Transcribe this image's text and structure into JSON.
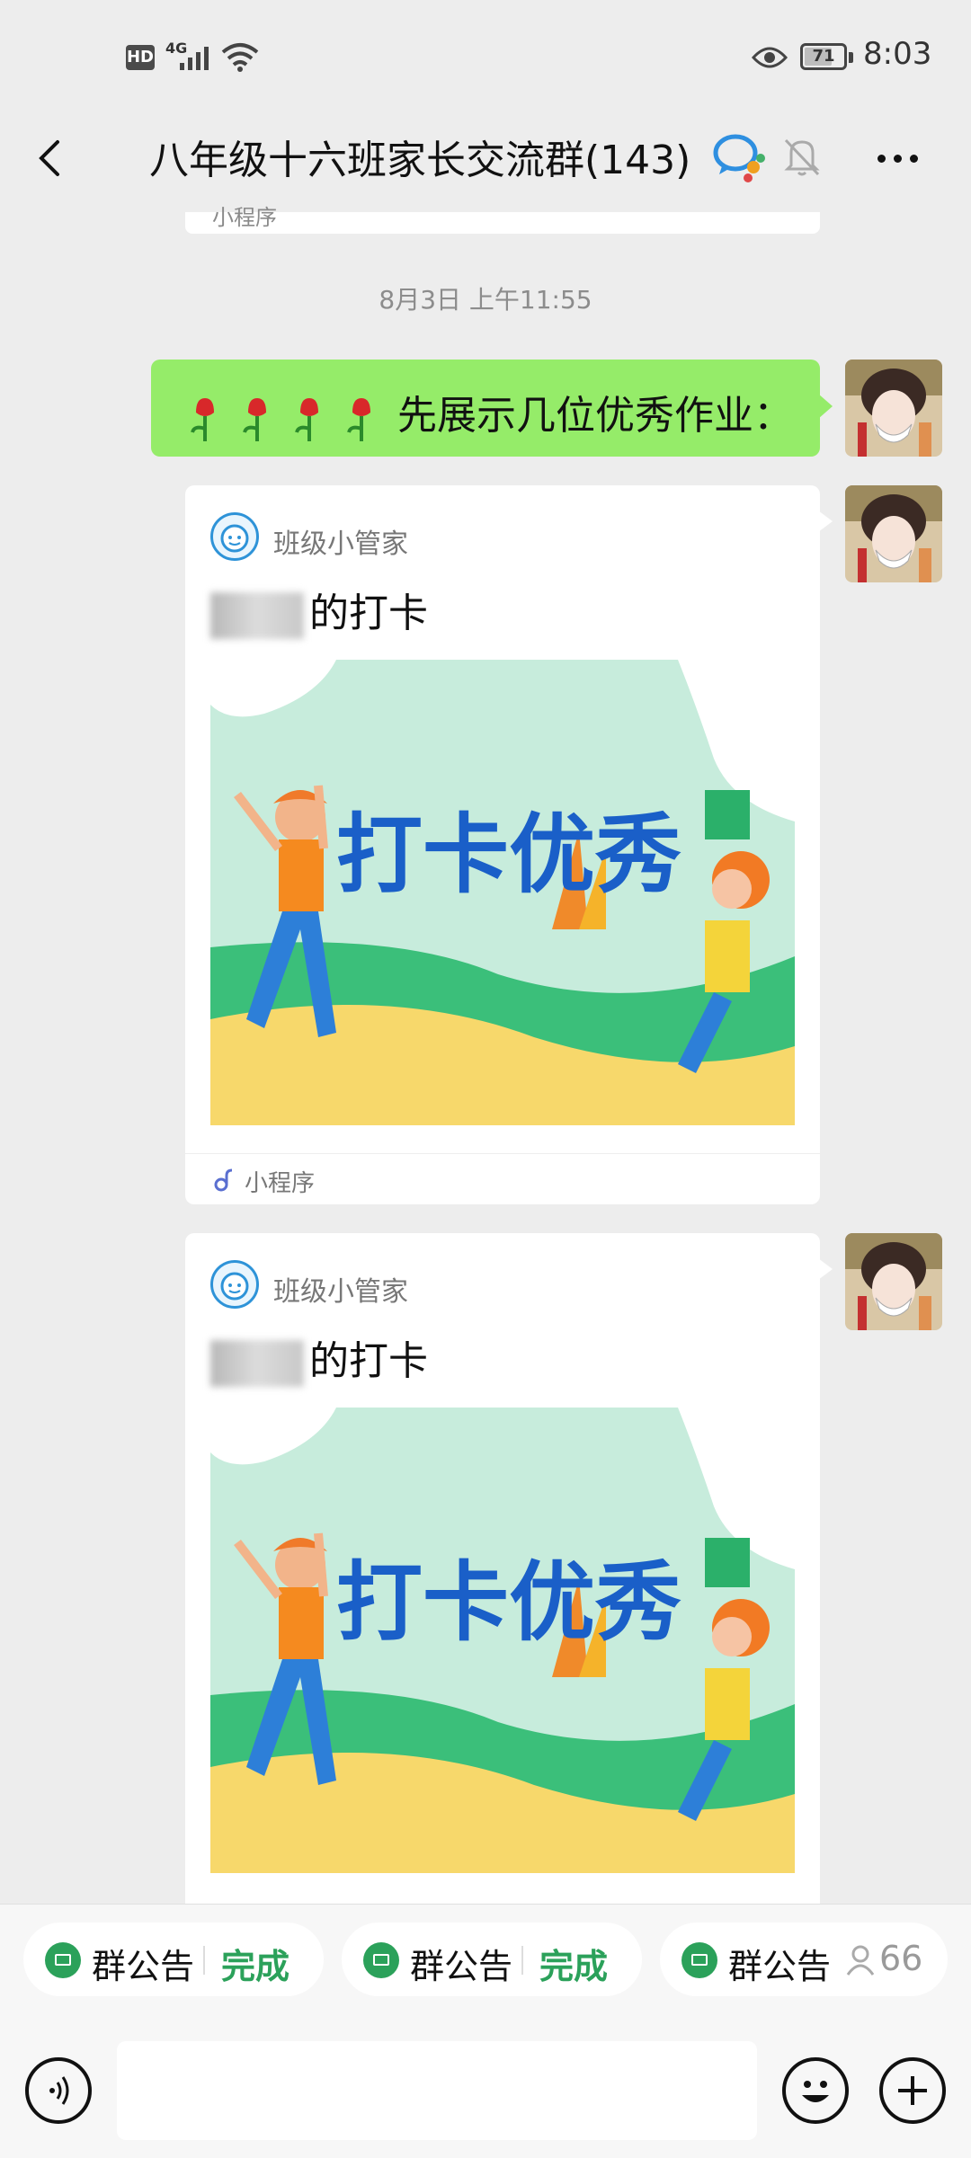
{
  "status_bar": {
    "hd": "HD",
    "network": "4G",
    "battery": "71",
    "battery_level": 0.71,
    "time": "8:03"
  },
  "nav": {
    "title": "八年级十六班家长交流群(143)"
  },
  "prev_card": {
    "source_label": "小程序"
  },
  "timestamp": "8月3日 上午11:55",
  "messages": {
    "text_message": "先展示几位优秀作业：",
    "cards": [
      {
        "app_name": "班级小管家",
        "title": "的打卡",
        "image_text": "打卡优秀",
        "source_label": "小程序"
      },
      {
        "app_name": "班级小管家",
        "title": "的打卡",
        "image_text": "打卡优秀"
      }
    ]
  },
  "bottom_pills": [
    {
      "label": "群公告",
      "status": "完成"
    },
    {
      "label": "群公告",
      "status": "完成"
    },
    {
      "label": "群公告",
      "count": "66"
    }
  ],
  "colors": {
    "background": "#ededed",
    "bubble_green": "#95ec69",
    "accent_green": "#2ba15a"
  }
}
